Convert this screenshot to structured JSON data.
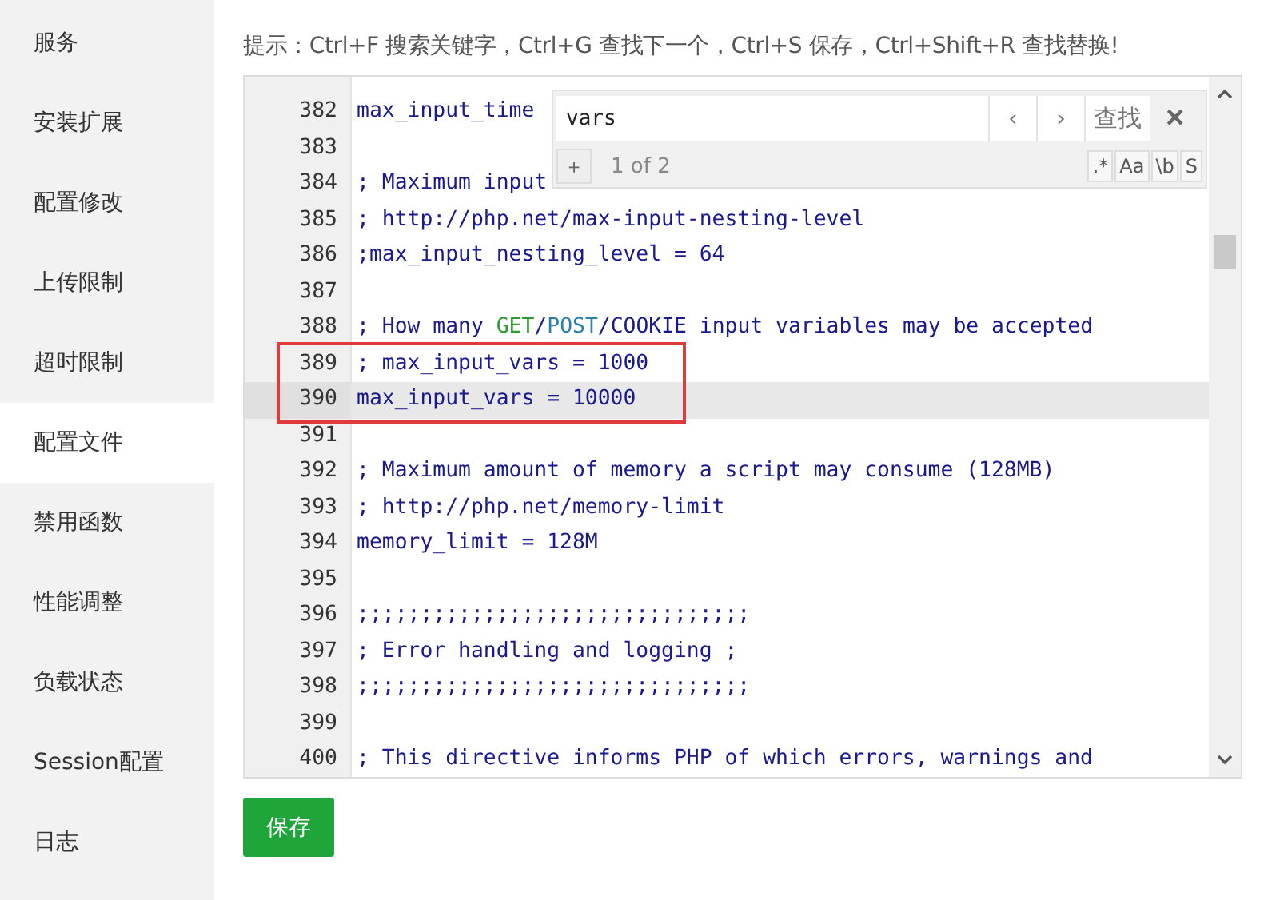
{
  "sidebar": {
    "items": [
      {
        "label": "服务",
        "selected": false
      },
      {
        "label": "安装扩展",
        "selected": false
      },
      {
        "label": "配置修改",
        "selected": false
      },
      {
        "label": "上传限制",
        "selected": false
      },
      {
        "label": "超时限制",
        "selected": false
      },
      {
        "label": "配置文件",
        "selected": true
      },
      {
        "label": "禁用函数",
        "selected": false
      },
      {
        "label": "性能调整",
        "selected": false
      },
      {
        "label": "负载状态",
        "selected": false
      },
      {
        "label": "Session配置",
        "selected": false
      },
      {
        "label": "日志",
        "selected": false
      }
    ]
  },
  "hint": "提示：Ctrl+F 搜索关键字，Ctrl+G 查找下一个，Ctrl+S 保存，Ctrl+Shift+R 查找替换!",
  "editor": {
    "lines": [
      {
        "number": "382",
        "active": false,
        "marked": false,
        "segments": [
          {
            "text": "max_input_time",
            "kind": "plain"
          }
        ]
      },
      {
        "number": "383",
        "active": false,
        "marked": false
      },
      {
        "number": "384",
        "active": false,
        "marked": false,
        "segments": [
          {
            "text": "; Maximum input",
            "kind": "comment"
          }
        ]
      },
      {
        "number": "385",
        "active": false,
        "marked": false,
        "segments": [
          {
            "text": "; http://php.net/max-input-nesting-level",
            "kind": "comment"
          }
        ]
      },
      {
        "number": "386",
        "active": false,
        "marked": false,
        "segments": [
          {
            "text": ";max_input_nesting_level = 64",
            "kind": "comment"
          }
        ]
      },
      {
        "number": "387",
        "active": false,
        "marked": false
      },
      {
        "number": "388",
        "active": false,
        "marked": false,
        "segments": [
          {
            "text": "; How many ",
            "kind": "comment"
          },
          {
            "text": "GET",
            "kind": "keyword"
          },
          {
            "text": "/",
            "kind": "comment"
          },
          {
            "text": "POST",
            "kind": "atom"
          },
          {
            "text": "/COOKIE input variables may be accepted",
            "kind": "comment"
          }
        ]
      },
      {
        "number": "389",
        "active": false,
        "marked": true,
        "segments": [
          {
            "text": "; max_input_vars = 1000",
            "kind": "comment"
          }
        ]
      },
      {
        "number": "390",
        "active": true,
        "marked": true,
        "segments": [
          {
            "text": "max_input_vars = 10000",
            "kind": "plain"
          }
        ]
      },
      {
        "number": "391",
        "active": false,
        "marked": false
      },
      {
        "number": "392",
        "active": false,
        "marked": false,
        "segments": [
          {
            "text": "; Maximum amount of memory a script may consume (128MB)",
            "kind": "comment"
          }
        ]
      },
      {
        "number": "393",
        "active": false,
        "marked": false,
        "segments": [
          {
            "text": "; http://php.net/memory-limit",
            "kind": "comment"
          }
        ]
      },
      {
        "number": "394",
        "active": false,
        "marked": false,
        "segments": [
          {
            "text": "memory_limit = 128M",
            "kind": "plain"
          }
        ]
      },
      {
        "number": "395",
        "active": false,
        "marked": false
      },
      {
        "number": "396",
        "active": false,
        "marked": false,
        "segments": [
          {
            "text": ";;;;;;;;;;;;;;;;;;;;;;;;;;;;;;;",
            "kind": "comment"
          }
        ]
      },
      {
        "number": "397",
        "active": false,
        "marked": false,
        "segments": [
          {
            "text": "; Error handling and logging ;",
            "kind": "comment"
          }
        ]
      },
      {
        "number": "398",
        "active": false,
        "marked": false,
        "segments": [
          {
            "text": ";;;;;;;;;;;;;;;;;;;;;;;;;;;;;;;",
            "kind": "comment"
          }
        ]
      },
      {
        "number": "399",
        "active": false,
        "marked": false
      },
      {
        "number": "400",
        "active": false,
        "marked": false,
        "segments": [
          {
            "text": "; This directive informs PHP of which errors, warnings and",
            "kind": "comment"
          }
        ]
      }
    ]
  },
  "search": {
    "value": "vars",
    "prev": "‹",
    "next": "›",
    "find": "查找",
    "close": "×",
    "expand": "+",
    "count": "1 of 2",
    "options": [
      ".*",
      "Aa",
      "\\b",
      "S"
    ]
  },
  "save_button": "保存"
}
